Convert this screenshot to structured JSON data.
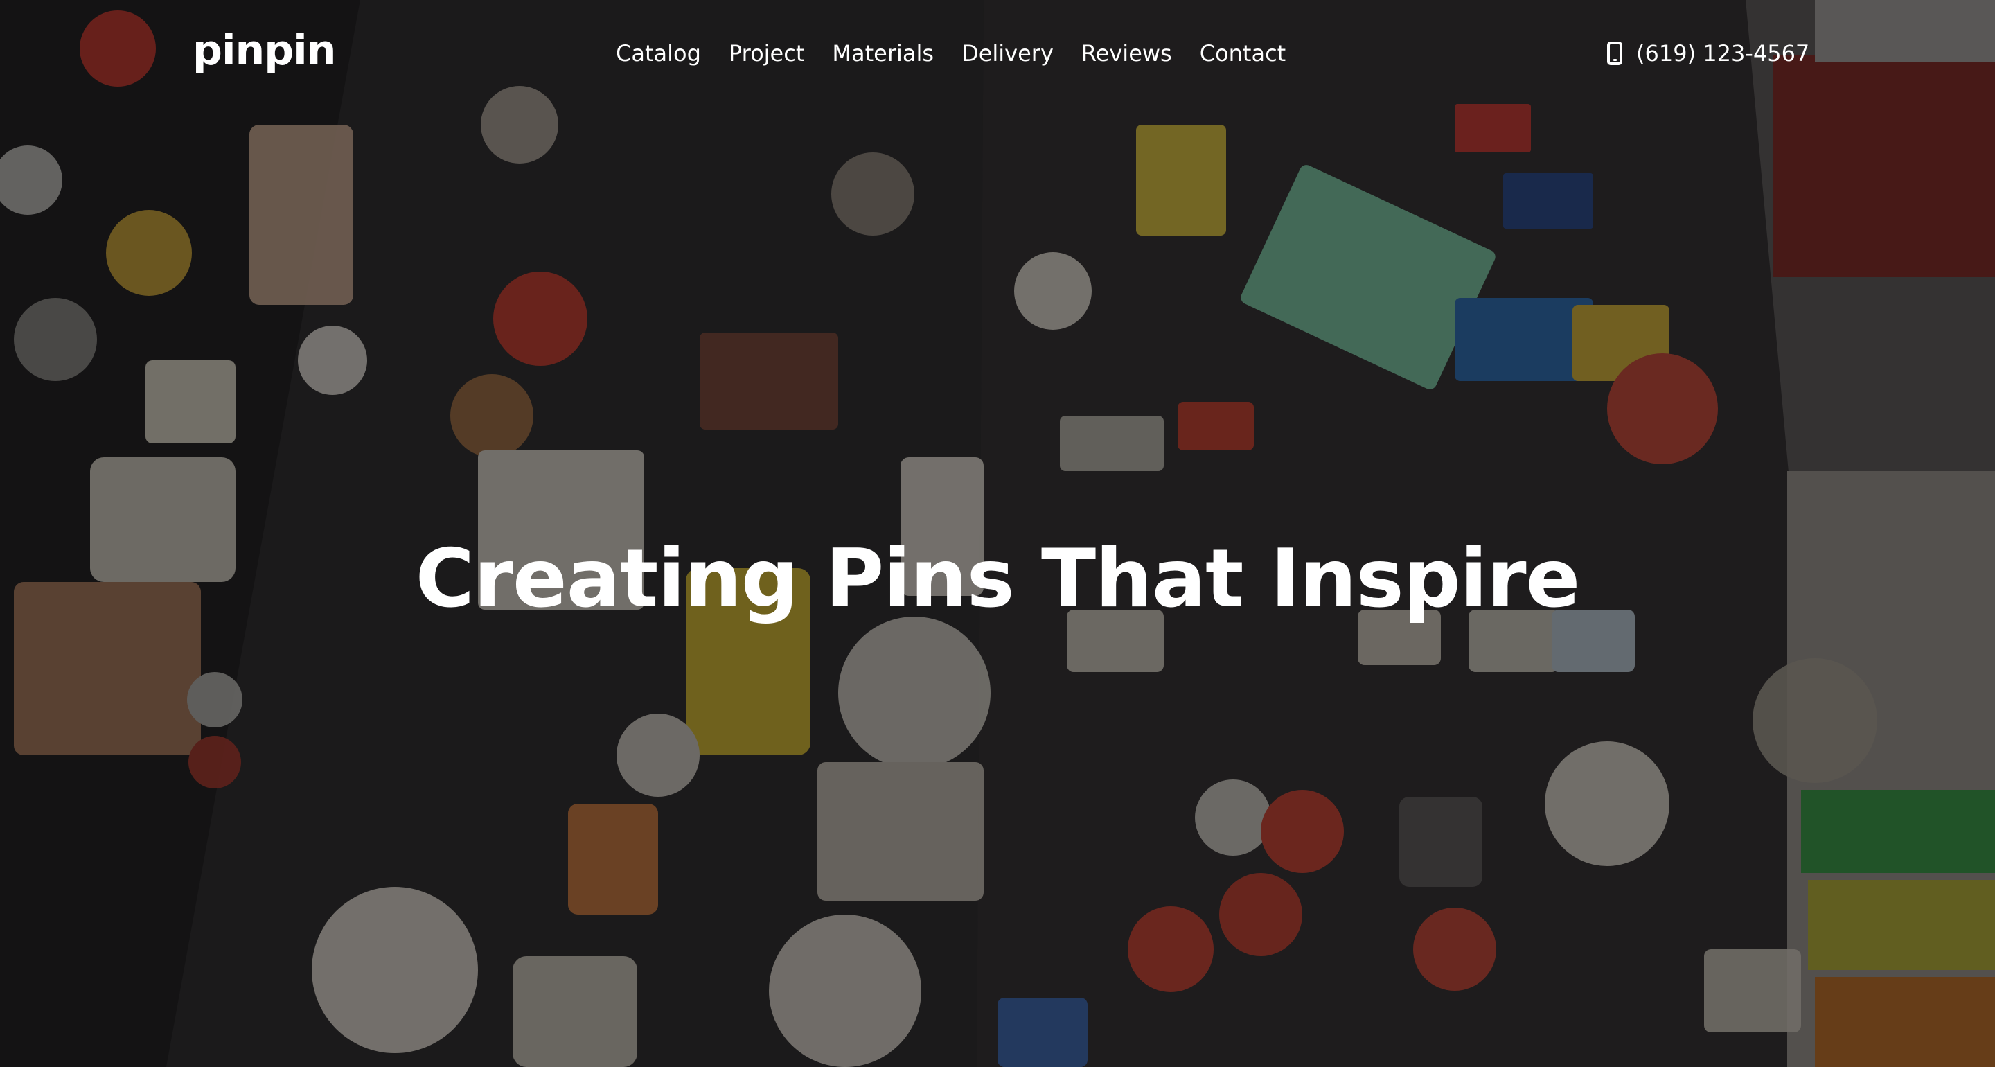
{
  "brand": {
    "logo_text": "pinpin"
  },
  "nav": {
    "items": [
      {
        "label": "Catalog"
      },
      {
        "label": "Project"
      },
      {
        "label": "Materials"
      },
      {
        "label": "Delivery"
      },
      {
        "label": "Reviews"
      },
      {
        "label": "Contact"
      }
    ]
  },
  "contact": {
    "phone": "(619) 123-4567",
    "icon": "mobile-phone-icon"
  },
  "hero": {
    "headline": "Creating Pins That Inspire",
    "background": "photo of vintage enamel pins and badges on dark boards",
    "text_color": "#ffffff"
  }
}
